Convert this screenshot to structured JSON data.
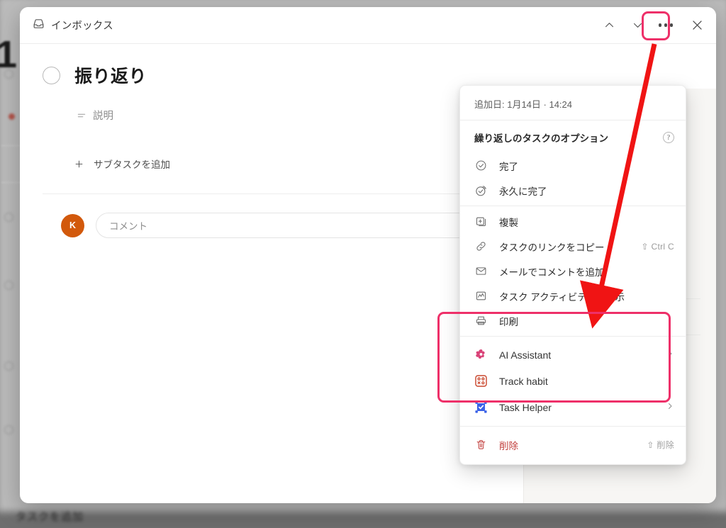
{
  "window": {
    "header_title": "インボックス",
    "header_icon": "inbox-icon",
    "buttons": {
      "prev_label": "前へ",
      "next_label": "次へ",
      "more_label": "その他のオプション",
      "close_label": "閉じる"
    }
  },
  "task": {
    "title": "振り返り",
    "description_placeholder": "説明",
    "add_subtask_label": "サブタスクを追加",
    "comment_placeholder": "コメント",
    "avatar_initial": "K"
  },
  "rail": {
    "items": [
      {
        "icon": "plus-icon",
        "name": "add-item"
      },
      {
        "icon": "lock-icon",
        "name": "lock-item-1"
      },
      {
        "icon": "lock-icon",
        "name": "lock-item-2"
      }
    ]
  },
  "context_menu": {
    "added_date": "追加日: 1月14日 · 14:24",
    "section_title": "繰り返しのタスクのオプション",
    "help_glyph": "?",
    "recurring_items": [
      {
        "icon": "check-circle-icon",
        "label": "完了",
        "shortcut": ""
      },
      {
        "icon": "check-circle-stack-icon",
        "label": "永久に完了",
        "shortcut": ""
      }
    ],
    "action_items": [
      {
        "icon": "duplicate-icon",
        "label": "複製",
        "shortcut": ""
      },
      {
        "icon": "link-icon",
        "label": "タスクのリンクをコピー",
        "shortcut": "⇧ Ctrl C"
      },
      {
        "icon": "mail-icon",
        "label": "メールでコメントを追加",
        "shortcut": ""
      },
      {
        "icon": "activity-icon",
        "label": "タスク アクティビティを表示",
        "shortcut": ""
      },
      {
        "icon": "printer-icon",
        "label": "印刷",
        "shortcut": ""
      }
    ],
    "integration_items": [
      {
        "icon": "ai-assistant-icon",
        "label": "AI Assistant",
        "has_submenu": true,
        "color": "#d63384"
      },
      {
        "icon": "track-habit-icon",
        "label": "Track habit",
        "has_submenu": false,
        "color": "#c9462c"
      },
      {
        "icon": "task-helper-icon",
        "label": "Task Helper",
        "has_submenu": true,
        "color": "#3b63e8"
      }
    ],
    "delete_item": {
      "icon": "trash-icon",
      "label": "削除",
      "shortcut": "⇧ 削除"
    }
  },
  "annotations": {
    "highlight_color": "#ee3069",
    "arrow_color": "#f01414",
    "more_button_highlight": "more-options-button",
    "group_highlight": "integration-apps-group"
  }
}
